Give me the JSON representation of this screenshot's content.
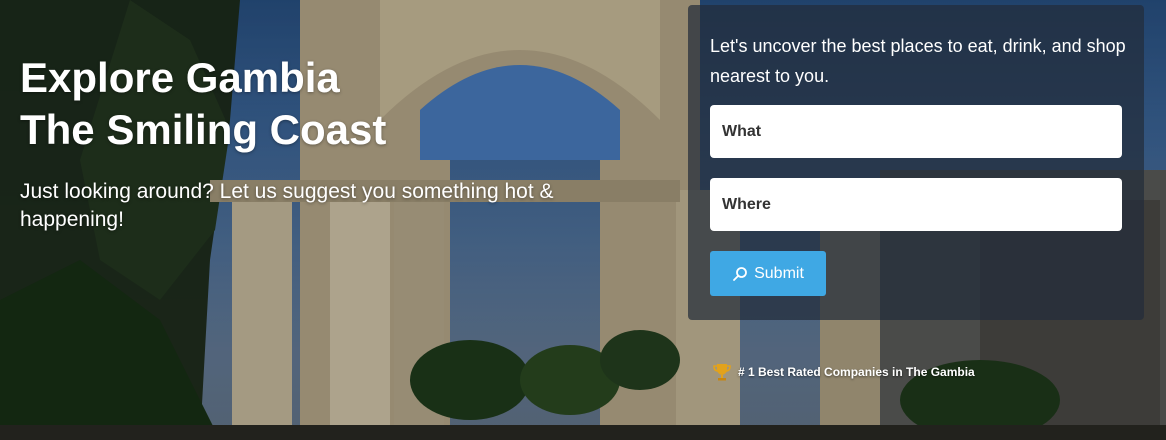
{
  "hero": {
    "title_line1": "Explore Gambia",
    "title_line2": "The Smiling Coast",
    "subtitle": "Just looking around? Let us suggest you something hot & happening!"
  },
  "search": {
    "intro": "Let's uncover the best places to eat, drink, and shop nearest to you.",
    "what_placeholder": "What",
    "where_placeholder": "Where",
    "submit_label": "Submit",
    "submit_icon": "search-icon"
  },
  "badge": {
    "icon": "trophy-icon",
    "text": "# 1 Best Rated Companies in The Gambia"
  },
  "colors": {
    "accent": "#3fa8e4",
    "panel": "#232d3a",
    "trophy": "#e2a21b"
  }
}
